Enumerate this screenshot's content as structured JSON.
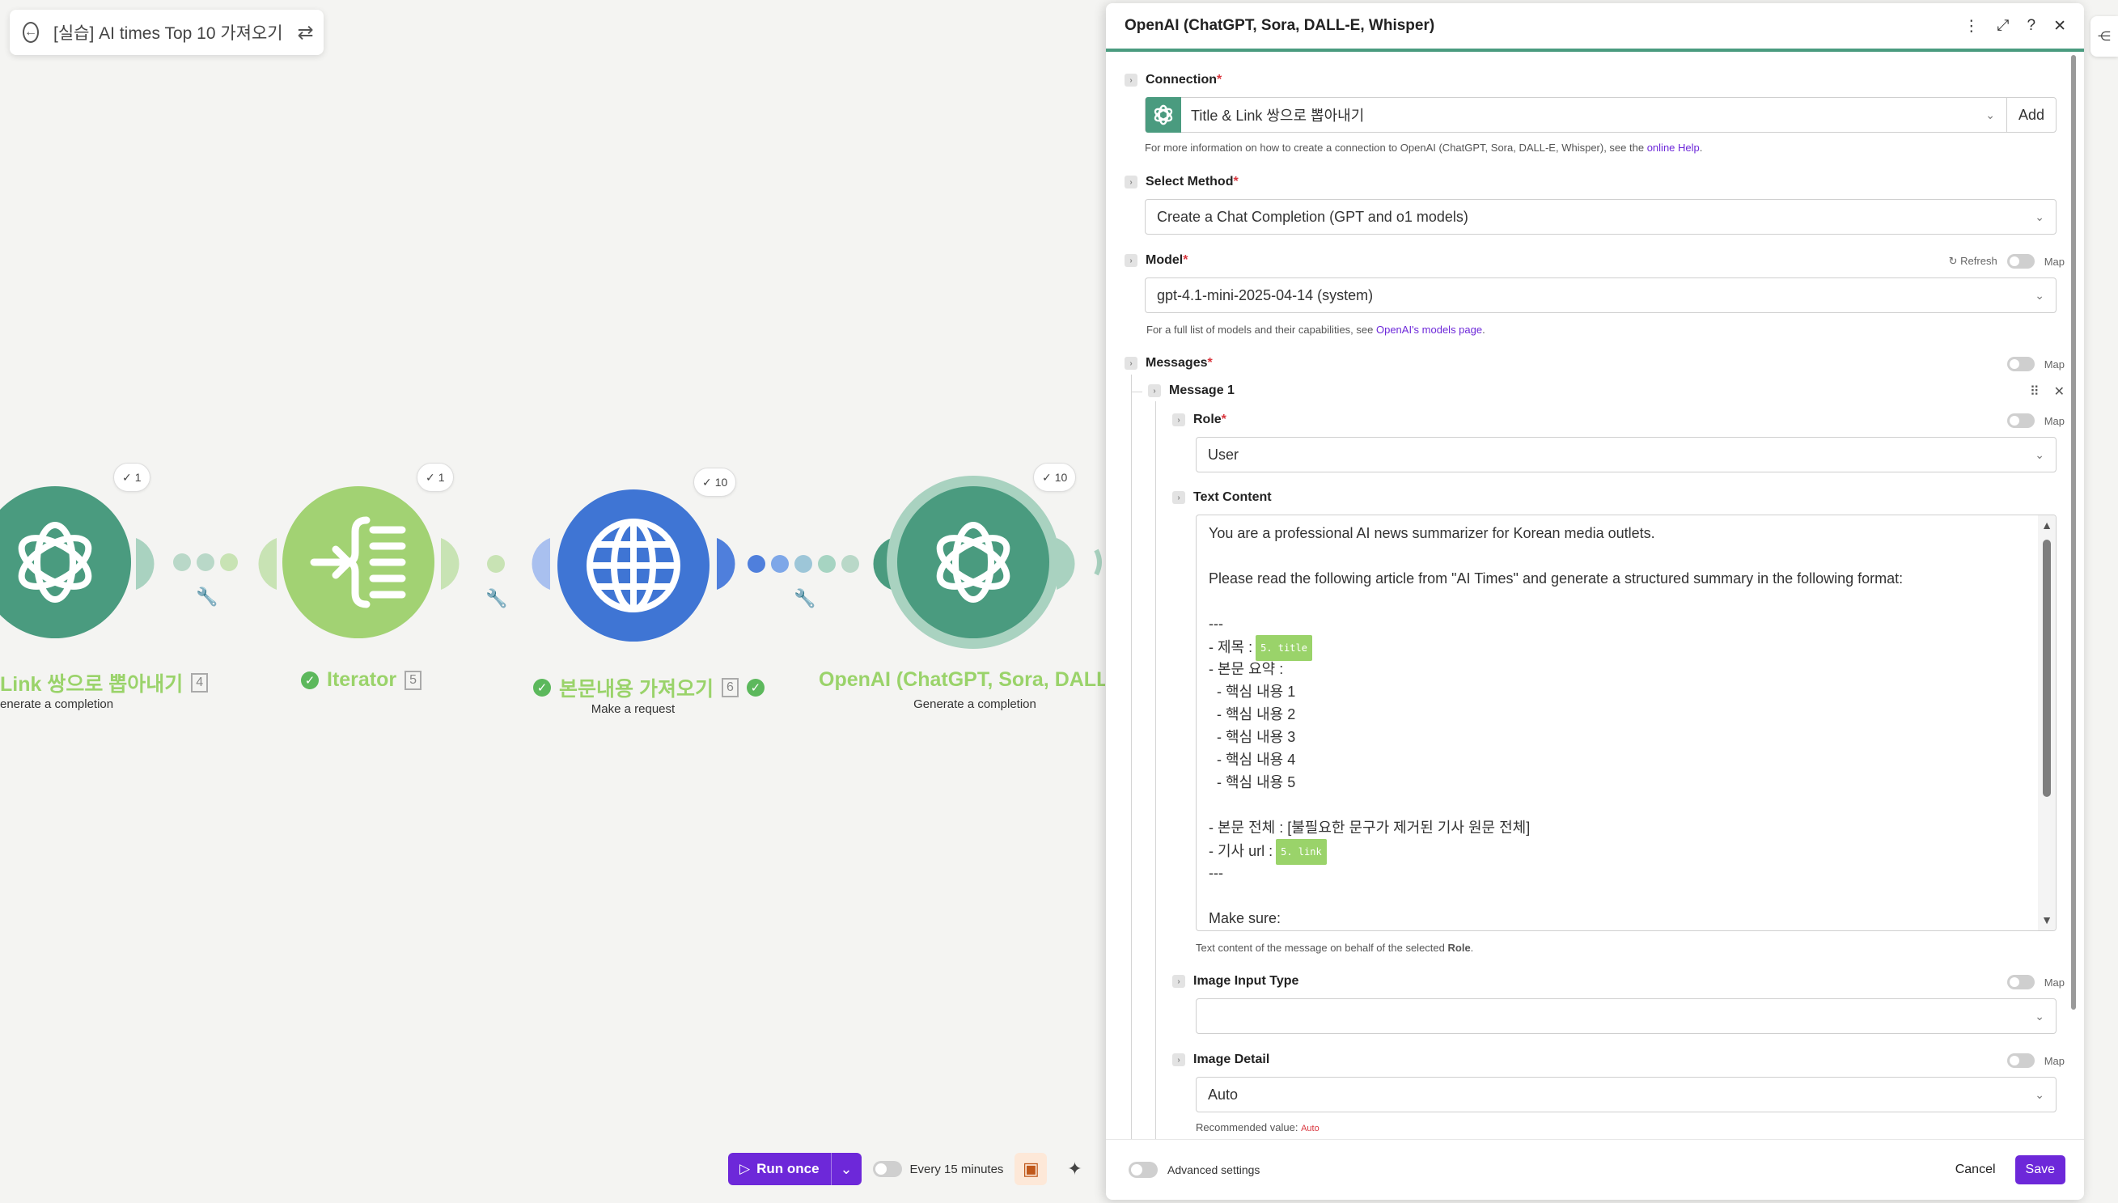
{
  "scenario": {
    "title": "[실습] AI times Top 10 가져오기"
  },
  "nodes": [
    {
      "label": "Link 쌍으로 뽑아내기",
      "id": "4",
      "subtitle": "enerate a completion",
      "badge": "1",
      "color": "#4a9b7f"
    },
    {
      "label": "Iterator",
      "id": "5",
      "subtitle": "",
      "badge": "1",
      "color": "#a2d273"
    },
    {
      "label": "본문내용 가져오기",
      "id": "6",
      "subtitle": "Make a request",
      "badge": "10",
      "color": "#3f75d4"
    },
    {
      "label": "OpenAI (ChatGPT, Sora, DALL-E, Whisp",
      "id": "",
      "subtitle": "Generate a completion",
      "badge": "10",
      "color": "#4a9b7f"
    }
  ],
  "toolbar": {
    "run_label": "Run once",
    "schedule_label": "Every 15 minutes"
  },
  "panel": {
    "title": "OpenAI (ChatGPT, Sora, DALL-E, Whisper)",
    "connection": {
      "label": "Connection",
      "value": "Title & Link 쌍으로 뽑아내기",
      "add_label": "Add",
      "help_prefix": "For more information on how to create a connection to OpenAI (ChatGPT, Sora, DALL-E, Whisper), see the",
      "help_link": "online Help",
      "help_suffix": "."
    },
    "method": {
      "label": "Select Method",
      "value": "Create a Chat Completion (GPT and o1 models)"
    },
    "model": {
      "label": "Model",
      "refresh_label": "Refresh",
      "map_label": "Map",
      "value": "gpt-4.1-mini-2025-04-14 (system)",
      "help_prefix": "For a full list of models and their capabilities, see",
      "help_link": "OpenAI's models page",
      "help_suffix": "."
    },
    "messages": {
      "label": "Messages",
      "map_label": "Map",
      "item_title": "Message 1",
      "role": {
        "label": "Role",
        "map_label": "Map",
        "value": "User"
      },
      "text_content": {
        "label": "Text Content",
        "line_1": "You are a professional AI news summarizer for Korean media outlets.",
        "line_2": "",
        "line_3": "Please read the following article from \"AI Times\" and generate a structured summary in the following format:",
        "line_4": "",
        "line_5": "---",
        "line_6": "- 제목 :",
        "pill_title": "5. title",
        "line_7": "- 본문 요약 :",
        "line_8": "  - 핵심 내용 1",
        "line_9": "  - 핵심 내용 2",
        "line_10": "  - 핵심 내용 3",
        "line_11": "  - 핵심 내용 4",
        "line_12": "  - 핵심 내용 5",
        "line_13": "",
        "line_14": "- 본문 전체 : [불필요한 문구가 제거된 기사 원문 전체]",
        "line_15": "- 기사 url :",
        "pill_link": "5. link",
        "line_16": "---",
        "line_17": "",
        "line_18": "Make sure:",
        "help_prefix": "Text content of the message on behalf of the selected",
        "help_bold": "Role",
        "help_suffix": "."
      },
      "image_input_type": {
        "label": "Image Input Type",
        "map_label": "Map",
        "value": ""
      },
      "image_detail": {
        "label": "Image Detail",
        "map_label": "Map",
        "value": "Auto",
        "recommended_prefix": "Recommended value:",
        "recommended_value": "Auto"
      }
    },
    "footer": {
      "advanced_label": "Advanced settings",
      "cancel_label": "Cancel",
      "save_label": "Save"
    }
  },
  "colors": {
    "accent": "#6d28d9",
    "openai_green": "#4a9b7f",
    "iterator_green": "#a2d273",
    "http_blue": "#3f75d4",
    "required": "#d9363e"
  }
}
